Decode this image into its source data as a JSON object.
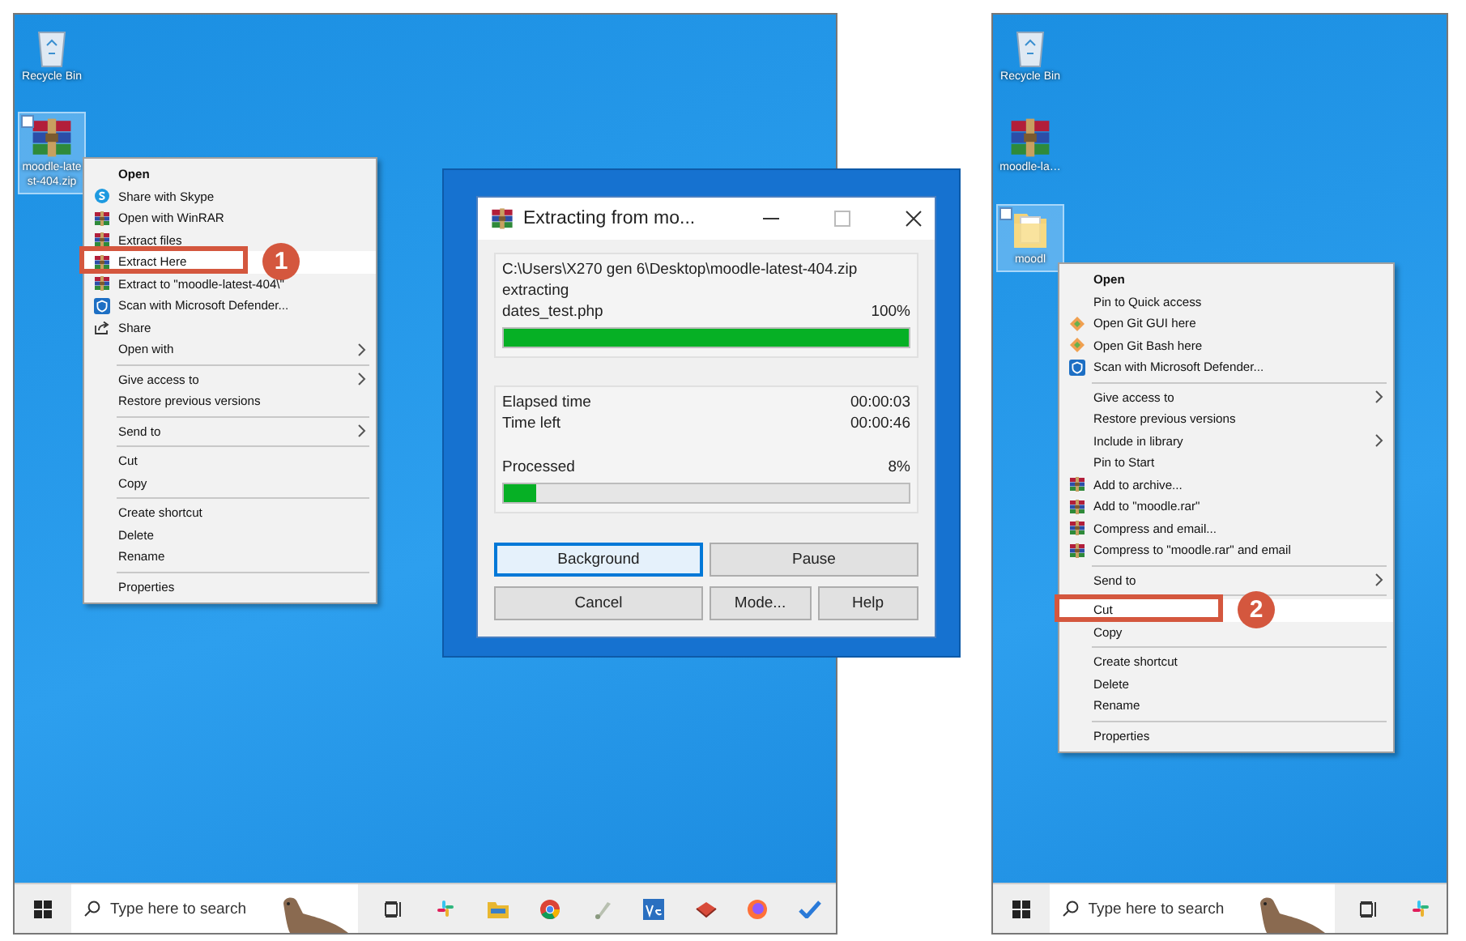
{
  "panels": [
    {
      "desktop_icons": [
        {
          "kind": "recycle",
          "label": "Recycle Bin",
          "selected": false
        },
        {
          "kind": "archive",
          "label": "moodle-latest-404.zip",
          "selected": true
        }
      ],
      "context_menu": {
        "items": [
          {
            "kind": "item",
            "label": "Open",
            "bold": true
          },
          {
            "kind": "skype",
            "label": "Share with Skype"
          },
          {
            "kind": "winrar",
            "label": "Open with WinRAR"
          },
          {
            "kind": "winrar",
            "label": "Extract files"
          },
          {
            "kind": "winrar",
            "label": "Extract Here",
            "highlighted": true,
            "callout": "1"
          },
          {
            "kind": "winrar",
            "label": "Extract to \"moodle-latest-404\\\""
          },
          {
            "kind": "defender",
            "label": "Scan with Microsoft Defender..."
          },
          {
            "kind": "share",
            "label": "Share"
          },
          {
            "kind": "item",
            "label": "Open with",
            "submenu": true
          },
          {
            "kind": "separator"
          },
          {
            "kind": "item",
            "label": "Give access to",
            "submenu": true
          },
          {
            "kind": "item",
            "label": "Restore previous versions"
          },
          {
            "kind": "separator"
          },
          {
            "kind": "item",
            "label": "Send to",
            "submenu": true
          },
          {
            "kind": "separator"
          },
          {
            "kind": "item",
            "label": "Cut"
          },
          {
            "kind": "item",
            "label": "Copy"
          },
          {
            "kind": "separator"
          },
          {
            "kind": "item",
            "label": "Create shortcut"
          },
          {
            "kind": "item",
            "label": "Delete"
          },
          {
            "kind": "item",
            "label": "Rename"
          },
          {
            "kind": "separator"
          },
          {
            "kind": "item",
            "label": "Properties"
          }
        ]
      },
      "dialog": {
        "title": "Extracting from mo...",
        "path": "C:\\Users\\X270 gen 6\\Desktop\\moodle-latest-404.zip",
        "action": "extracting",
        "file": "dates_test.php",
        "file_percent": "100%",
        "file_progress": {
          "level": 1
        },
        "times": [
          {
            "label": "Elapsed time",
            "value": "00:00:03"
          },
          {
            "label": "Time left",
            "value": "00:00:46"
          }
        ],
        "processed_label": "Processed",
        "processed_percent": "8%",
        "processed_progress": {
          "level": 0.08
        },
        "buttons": [
          {
            "label": "Background",
            "focused": true
          },
          {
            "label": "Pause",
            "focused": false
          },
          {
            "label": "Cancel",
            "focused": false
          },
          {
            "label": "Mode...",
            "focused": false
          },
          {
            "label": "Help",
            "focused": false
          }
        ]
      },
      "taskbar": {
        "search": {
          "placeholder": "Type here to search"
        },
        "pinned": [
          {
            "kind": "taskview"
          },
          {
            "kind": "slack"
          },
          {
            "kind": "files"
          },
          {
            "kind": "chrome"
          },
          {
            "kind": "paint"
          },
          {
            "kind": "ve"
          },
          {
            "kind": "book"
          },
          {
            "kind": "firefox"
          },
          {
            "kind": "check"
          }
        ]
      }
    },
    {
      "desktop_icons": [
        {
          "kind": "recycle",
          "label": "Recycle Bin",
          "selected": false
        },
        {
          "kind": "archive",
          "label": "moodle-la…",
          "selected": false
        },
        {
          "kind": "folder",
          "label": "moodl",
          "selected": true
        }
      ],
      "context_menu": {
        "items": [
          {
            "kind": "item",
            "label": "Open",
            "bold": true
          },
          {
            "kind": "item",
            "label": "Pin to Quick access"
          },
          {
            "kind": "git",
            "label": "Open Git GUI here"
          },
          {
            "kind": "git",
            "label": "Open Git Bash here"
          },
          {
            "kind": "defender",
            "label": "Scan with Microsoft Defender..."
          },
          {
            "kind": "separator"
          },
          {
            "kind": "item",
            "label": "Give access to",
            "submenu": true
          },
          {
            "kind": "item",
            "label": "Restore previous versions"
          },
          {
            "kind": "item",
            "label": "Include in library",
            "submenu": true
          },
          {
            "kind": "item",
            "label": "Pin to Start"
          },
          {
            "kind": "winrar",
            "label": "Add to archive..."
          },
          {
            "kind": "winrar",
            "label": "Add to \"moodle.rar\""
          },
          {
            "kind": "winrar",
            "label": "Compress and email..."
          },
          {
            "kind": "winrar",
            "label": "Compress to \"moodle.rar\" and email"
          },
          {
            "kind": "separator"
          },
          {
            "kind": "item",
            "label": "Send to",
            "submenu": true
          },
          {
            "kind": "separator"
          },
          {
            "kind": "item",
            "label": "Cut",
            "highlighted": true,
            "callout": "2"
          },
          {
            "kind": "item",
            "label": "Copy"
          },
          {
            "kind": "separator"
          },
          {
            "kind": "item",
            "label": "Create shortcut"
          },
          {
            "kind": "item",
            "label": "Delete"
          },
          {
            "kind": "item",
            "label": "Rename"
          },
          {
            "kind": "separator"
          },
          {
            "kind": "item",
            "label": "Properties"
          }
        ]
      },
      "taskbar": {
        "search": {
          "placeholder": "Type here to search"
        },
        "pinned": [
          {
            "kind": "taskview"
          },
          {
            "kind": "slack"
          }
        ]
      }
    }
  ]
}
